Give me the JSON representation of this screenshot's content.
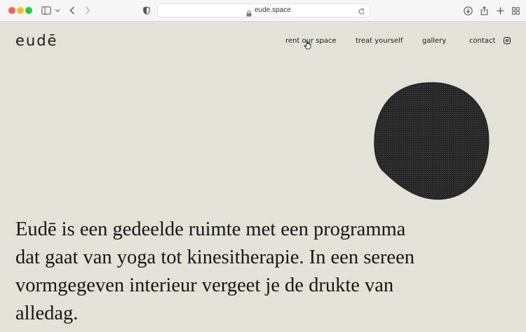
{
  "browser": {
    "url": "eude.space",
    "icons": [
      "sidebar-icon",
      "chevron-down-icon",
      "back-icon",
      "forward-icon",
      "shield-icon",
      "lock-icon",
      "reload-icon",
      "download-icon",
      "share-icon",
      "plus-icon",
      "tabs-grid-icon"
    ]
  },
  "site": {
    "logo": "eudē",
    "nav": {
      "rent": "rent our space",
      "treat": "treat yourself",
      "gallery": "gallery",
      "contact": "contact"
    },
    "intro": "Eudē is een gedeelde ruimte met een programma dat gaat van yoga tot kinesitherapie. In een sereen vormgegeven interieur vergeet je de drukte van alledag."
  },
  "colors": {
    "background": "#e3e2d9",
    "text": "#161616",
    "blob": "#262626"
  }
}
